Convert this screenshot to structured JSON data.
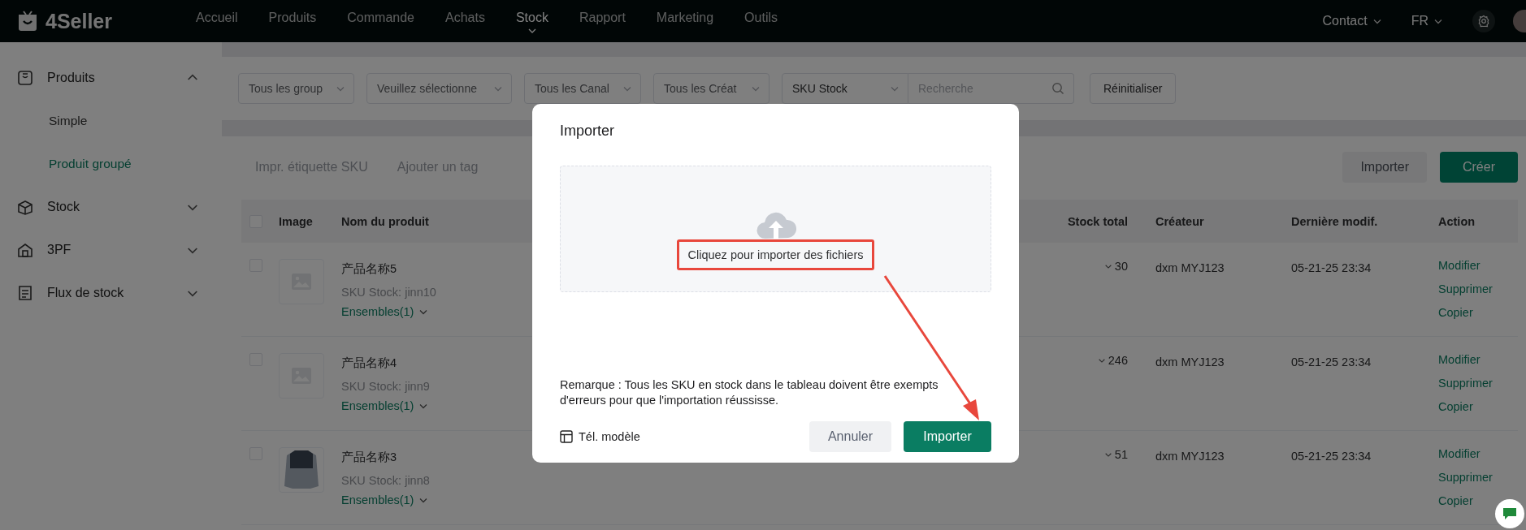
{
  "top_bar": {
    "logo": "4Seller",
    "nav": [
      {
        "label": "Accueil",
        "selected": false
      },
      {
        "label": "Produits",
        "selected": false
      },
      {
        "label": "Commande",
        "selected": false
      },
      {
        "label": "Achats",
        "selected": false
      },
      {
        "label": "Stock",
        "selected": true
      },
      {
        "label": "Rapport",
        "selected": false
      },
      {
        "label": "Marketing",
        "selected": false
      },
      {
        "label": "Outils",
        "selected": false
      }
    ],
    "contact": "Contact",
    "language": "FR"
  },
  "sidebar": {
    "items": [
      {
        "label": "Produits",
        "expanded": true,
        "children": [
          {
            "label": "Simple",
            "selected": false
          },
          {
            "label": "Produit groupé",
            "selected": true
          }
        ]
      },
      {
        "label": "Stock",
        "expanded": false
      },
      {
        "label": "3PF",
        "expanded": false
      },
      {
        "label": "Flux de stock",
        "expanded": false
      }
    ]
  },
  "filters": {
    "selects": [
      "Tous les group",
      "Veuillez sélectionne",
      "Tous les Canal",
      "Tous les Créat"
    ],
    "search_type": "SKU Stock",
    "search": {
      "placeholder": "Recherche"
    },
    "reset": "Réinitialiser"
  },
  "toolbar": {
    "actions": [
      {
        "label": "Impr. étiquette SKU",
        "disabled": true
      },
      {
        "label": "Ajouter un tag",
        "disabled": true
      }
    ],
    "import": "Importer",
    "create": "Créer"
  },
  "table": {
    "all_checked": false,
    "columns": [
      "Image",
      "Nom du produit",
      "Stock total",
      "Créateur",
      "Dernière modif.",
      "Action"
    ],
    "rows": [
      {
        "checked": false,
        "kind": "placeholder",
        "name": "产品名称5",
        "sku": "SKU Stock: jinn10",
        "sets": "Ensembles(1)",
        "stock_total": "30",
        "creator": "dxm MYJ123",
        "modified": "05-21-25 23:34",
        "actions": [
          "Modifier",
          "Supprimer",
          "Copier"
        ]
      },
      {
        "checked": false,
        "kind": "placeholder",
        "name": "产品名称4",
        "sku": "SKU Stock: jinn9",
        "sets": "Ensembles(1)",
        "stock_total": "246",
        "creator": "dxm MYJ123",
        "modified": "05-21-25 23:34",
        "actions": [
          "Modifier",
          "Supprimer",
          "Copier"
        ]
      },
      {
        "checked": false,
        "kind": "photo",
        "name": "产品名称3",
        "sku": "SKU Stock: jinn8",
        "sets": "Ensembles(1)",
        "stock_total": "51",
        "creator": "dxm MYJ123",
        "modified": "05-21-25 23:34",
        "actions": [
          "Modifier",
          "Supprimer",
          "Copier"
        ]
      }
    ]
  },
  "modal": {
    "title": "Importer",
    "upload_hint": "Cliquez pour importer des fichiers",
    "remark": "Remarque : Tous les SKU en stock dans le tableau doivent être exempts d'erreurs pour que l'importation réussisse.",
    "template_link": "Tél. modèle",
    "cancel": "Annuler",
    "confirm": "Importer"
  }
}
